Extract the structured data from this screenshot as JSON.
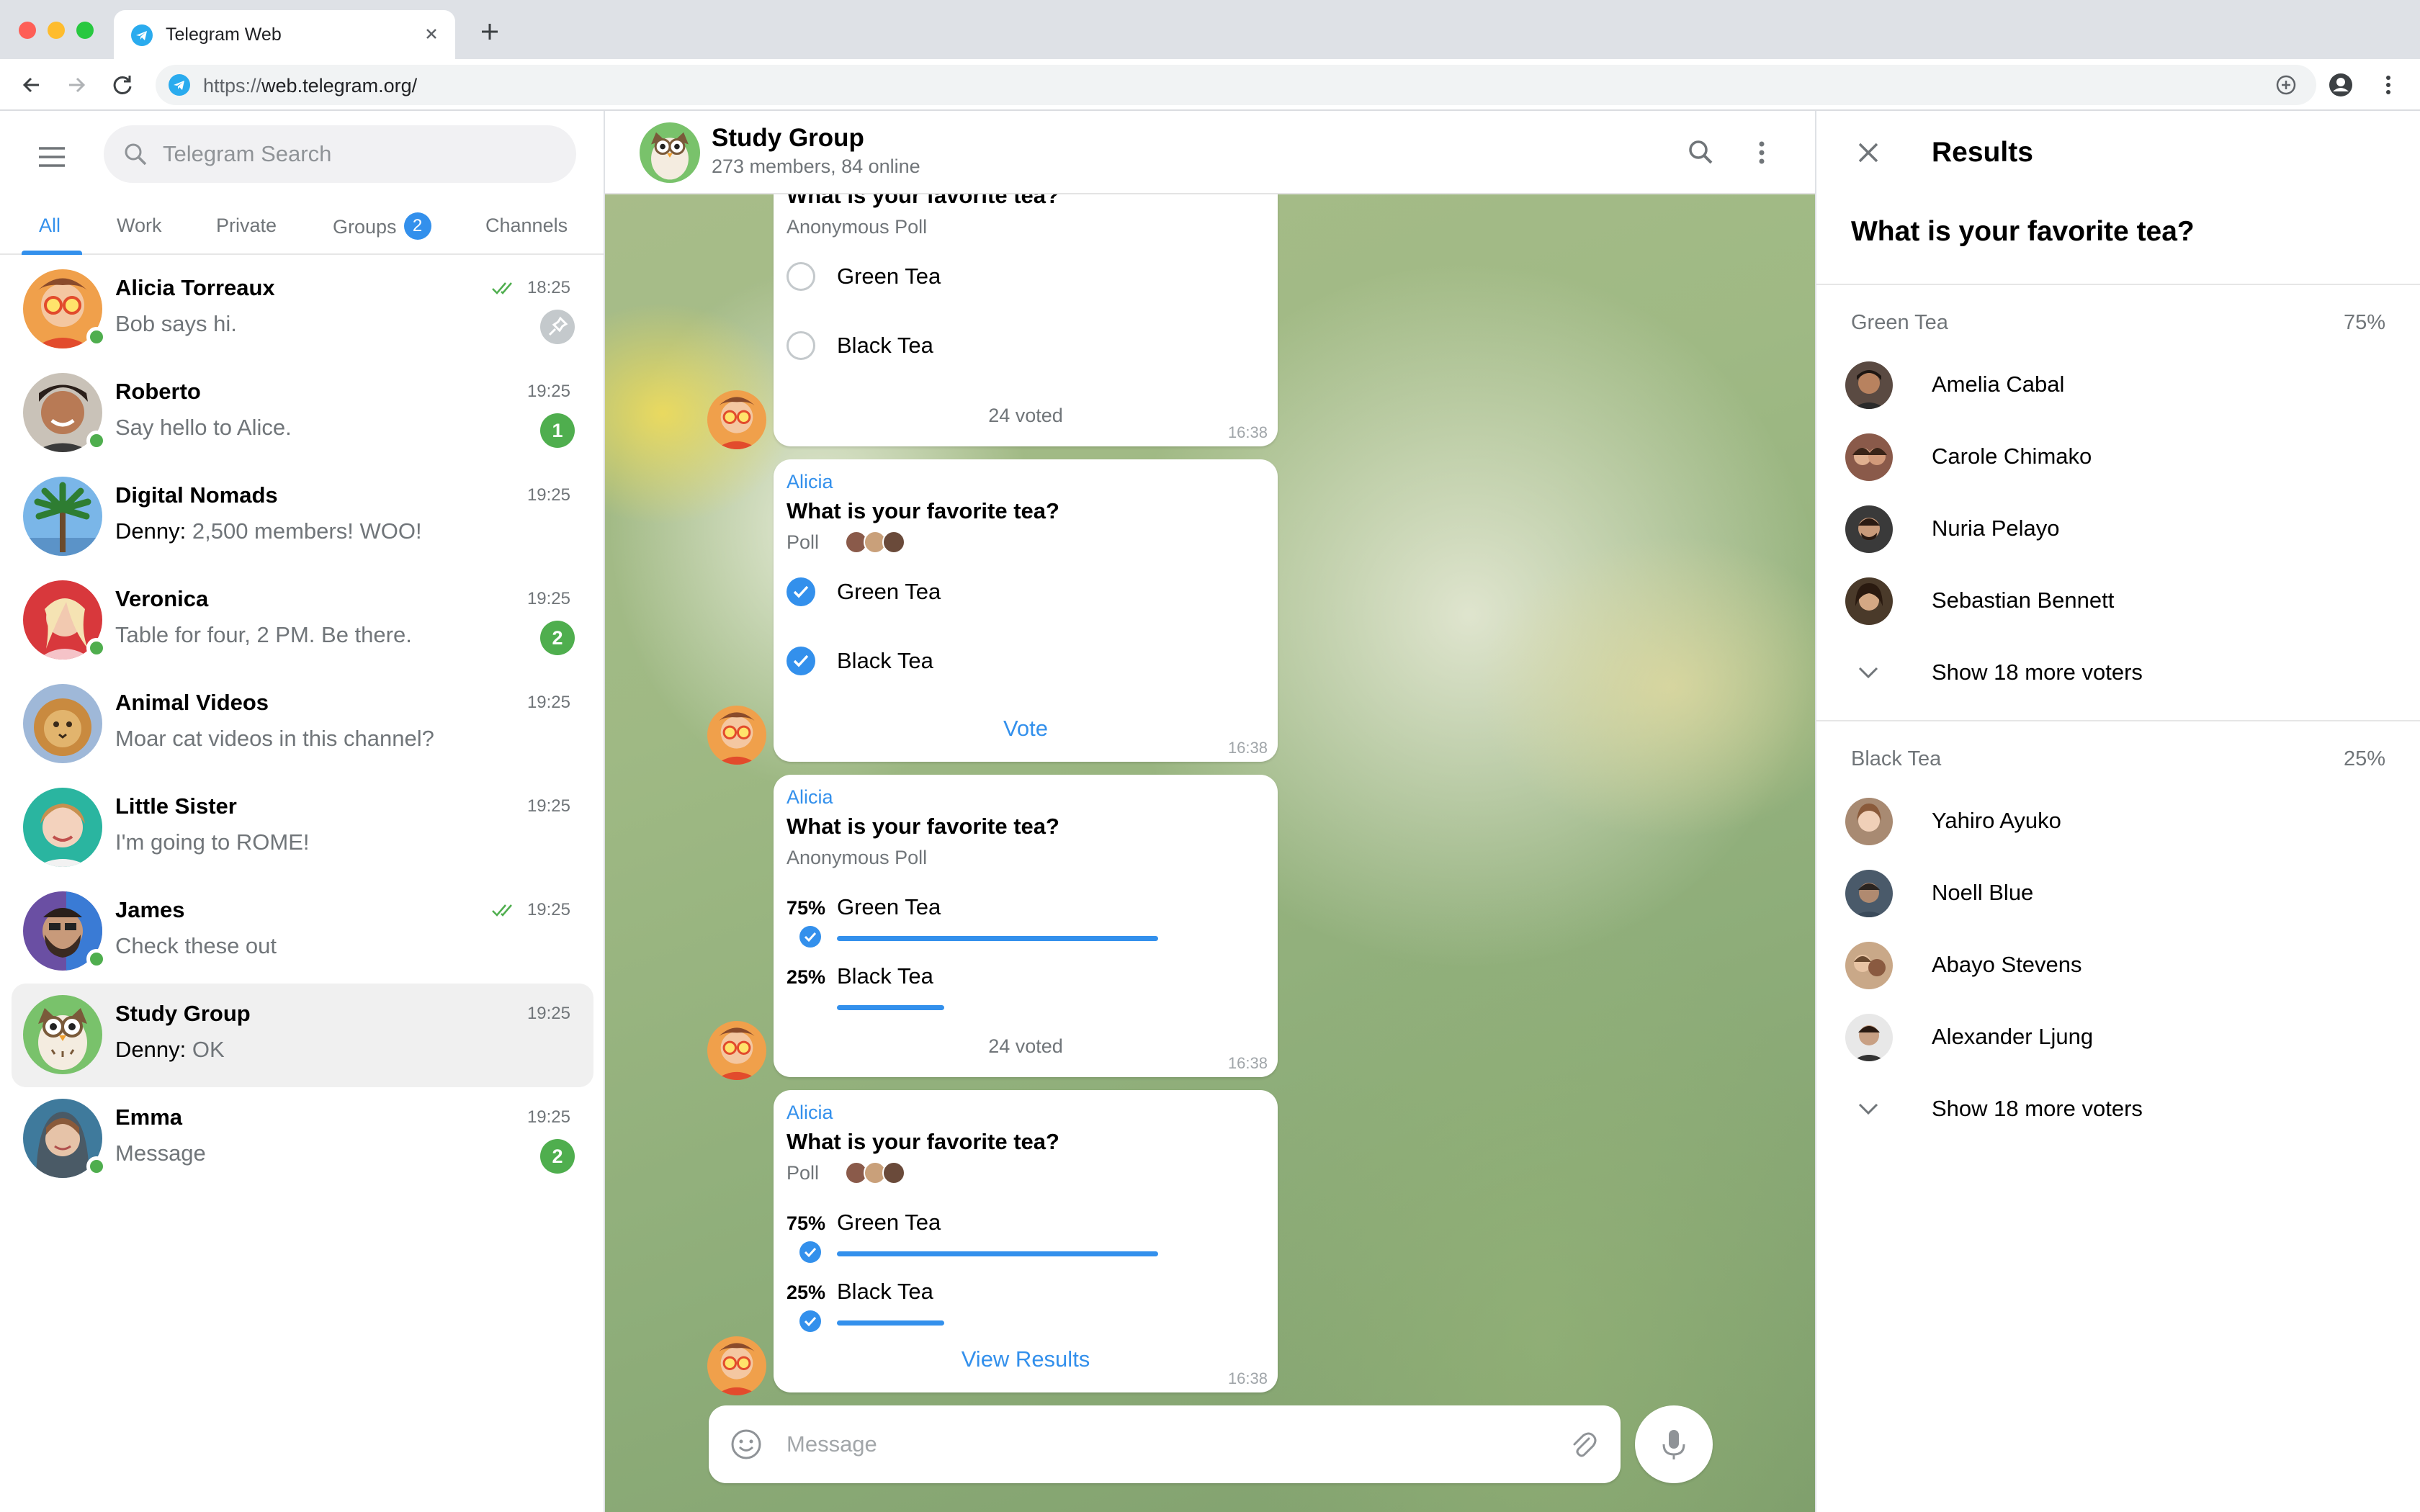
{
  "browser": {
    "tab_title": "Telegram Web",
    "url_prefix": "https://",
    "url_host": "web.telegram.org/"
  },
  "sidebar": {
    "search_placeholder": "Telegram Search",
    "folders": [
      {
        "label": "All",
        "active": true
      },
      {
        "label": "Work"
      },
      {
        "label": "Private"
      },
      {
        "label": "Groups",
        "badge": "2"
      },
      {
        "label": "Channels"
      }
    ],
    "chats": [
      {
        "name": "Alicia Torreaux",
        "time": "18:25",
        "message": "Bob says hi.",
        "read_check": true,
        "pinned": true,
        "online": true,
        "avatar": "alicia"
      },
      {
        "name": "Roberto",
        "time": "19:25",
        "message": "Say hello to Alice.",
        "unread": "1",
        "online": true,
        "avatar": "roberto"
      },
      {
        "name": "Digital Nomads",
        "time": "19:25",
        "sender": "Denny:",
        "message": "2,500 members! WOO!",
        "avatar": "nomads"
      },
      {
        "name": "Veronica",
        "time": "19:25",
        "message": "Table for four, 2 PM. Be there.",
        "unread": "2",
        "online": true,
        "avatar": "veronica"
      },
      {
        "name": "Animal Videos",
        "time": "19:25",
        "message": "Moar cat videos in this channel?",
        "avatar": "lion"
      },
      {
        "name": "Little Sister",
        "time": "19:25",
        "message": "I'm going to ROME!",
        "avatar": "sister"
      },
      {
        "name": "James",
        "time": "19:25",
        "message": "Check these out",
        "read_check": true,
        "online": true,
        "avatar": "james"
      },
      {
        "name": "Study Group",
        "time": "19:25",
        "sender": "Denny:",
        "message": "OK",
        "selected": true,
        "avatar": "owl"
      },
      {
        "name": "Emma",
        "time": "19:25",
        "message": "Message",
        "unread": "2",
        "online": true,
        "avatar": "emma"
      }
    ]
  },
  "chat": {
    "title": "Study Group",
    "subtitle": "273 members, 84 online",
    "messages": [
      {
        "question": "What is your favorite tea?",
        "type": "Anonymous Poll",
        "options": [
          "Green Tea",
          "Black Tea"
        ],
        "footer": "24 voted",
        "time": "16:38"
      },
      {
        "sender": "Alicia",
        "question": "What is your favorite tea?",
        "type": "Poll",
        "options": [
          "Green Tea",
          "Black Tea"
        ],
        "action": "Vote",
        "time": "16:38"
      },
      {
        "sender": "Alicia",
        "question": "What is your favorite tea?",
        "type": "Anonymous Poll",
        "results": [
          {
            "label": "Green Tea",
            "pct": "75%",
            "value": 0.75
          },
          {
            "label": "Black Tea",
            "pct": "25%",
            "value": 0.25
          }
        ],
        "footer": "24 voted",
        "time": "16:38"
      },
      {
        "sender": "Alicia",
        "question": "What is your favorite tea?",
        "type": "Poll",
        "results": [
          {
            "label": "Green Tea",
            "pct": "75%",
            "value": 0.75
          },
          {
            "label": "Black Tea",
            "pct": "25%",
            "value": 0.25
          }
        ],
        "action": "View Results",
        "time": "16:38"
      }
    ],
    "composer_placeholder": "Message"
  },
  "results": {
    "title": "Results",
    "question": "What is your favorite tea?",
    "sections": [
      {
        "label": "Green Tea",
        "pct": "75%",
        "voters": [
          "Amelia Cabal",
          "Carole Chimako",
          "Nuria Pelayo",
          "Sebastian Bennett"
        ],
        "show_more": "Show 18 more voters"
      },
      {
        "label": "Black Tea",
        "pct": "25%",
        "voters": [
          "Yahiro Ayuko",
          "Noell Blue",
          "Abayo Stevens",
          "Alexander Ljung"
        ],
        "show_more": "Show 18 more voters"
      }
    ]
  },
  "colors": {
    "accent": "#3390ec",
    "unread_badge": "#4fae4e",
    "online": "#4fae4e"
  }
}
